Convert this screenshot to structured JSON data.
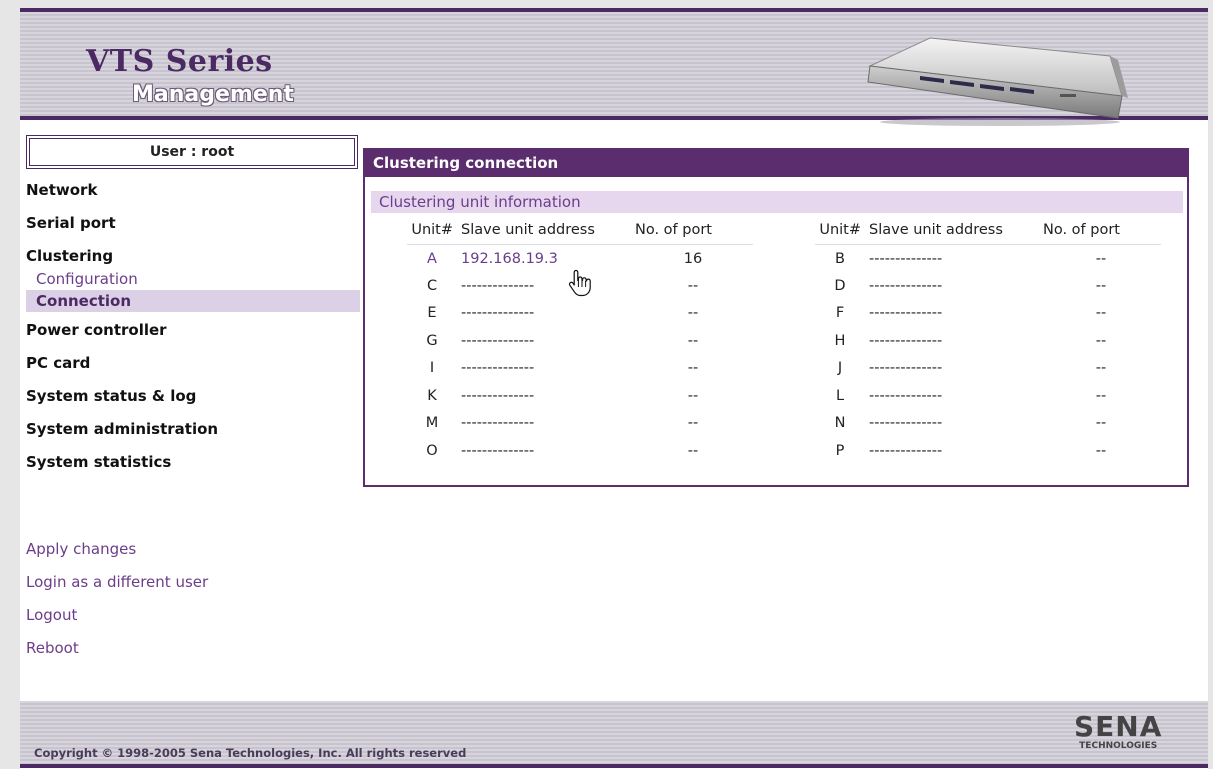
{
  "header": {
    "title": "VTS Series",
    "subtitle": "Management"
  },
  "sidebar": {
    "user_label": "User : root",
    "items": [
      {
        "label": "Network"
      },
      {
        "label": "Serial port"
      },
      {
        "label": "Clustering"
      },
      {
        "label": "Configuration"
      },
      {
        "label": "Connection"
      },
      {
        "label": "Power controller"
      },
      {
        "label": "PC card"
      },
      {
        "label": "System status & log"
      },
      {
        "label": "System administration"
      },
      {
        "label": "System statistics"
      }
    ],
    "links": [
      {
        "label": "Apply changes"
      },
      {
        "label": "Login as a different user"
      },
      {
        "label": "Logout"
      },
      {
        "label": "Reboot"
      }
    ]
  },
  "main": {
    "panel_title": "Clustering connection",
    "section_title": "Clustering unit information",
    "columns": {
      "unit": "Unit#",
      "address": "Slave unit address",
      "ports": "No. of port"
    },
    "left_rows": [
      {
        "unit": "A",
        "address": "192.168.19.3",
        "ports": "16"
      },
      {
        "unit": "C",
        "address": "--------------",
        "ports": "--"
      },
      {
        "unit": "E",
        "address": "--------------",
        "ports": "--"
      },
      {
        "unit": "G",
        "address": "--------------",
        "ports": "--"
      },
      {
        "unit": "I",
        "address": "--------------",
        "ports": "--"
      },
      {
        "unit": "K",
        "address": "--------------",
        "ports": "--"
      },
      {
        "unit": "M",
        "address": "--------------",
        "ports": "--"
      },
      {
        "unit": "O",
        "address": "--------------",
        "ports": "--"
      }
    ],
    "right_rows": [
      {
        "unit": "B",
        "address": "--------------",
        "ports": "--"
      },
      {
        "unit": "D",
        "address": "--------------",
        "ports": "--"
      },
      {
        "unit": "F",
        "address": "--------------",
        "ports": "--"
      },
      {
        "unit": "H",
        "address": "--------------",
        "ports": "--"
      },
      {
        "unit": "J",
        "address": "--------------",
        "ports": "--"
      },
      {
        "unit": "L",
        "address": "--------------",
        "ports": "--"
      },
      {
        "unit": "N",
        "address": "--------------",
        "ports": "--"
      },
      {
        "unit": "P",
        "address": "--------------",
        "ports": "--"
      }
    ]
  },
  "footer": {
    "copyright": "Copyright © 1998-2005 Sena Technologies, Inc. All rights reserved",
    "logo_main": "SENA",
    "logo_sub": "TECHNOLOGIES"
  },
  "colors": {
    "brand_purple": "#5b2d6f",
    "link_purple": "#6b3d8a",
    "section_bg": "#e6d6ee"
  },
  "icons": [
    "device-illustration",
    "hand-pointer-icon",
    "sena-logo"
  ]
}
